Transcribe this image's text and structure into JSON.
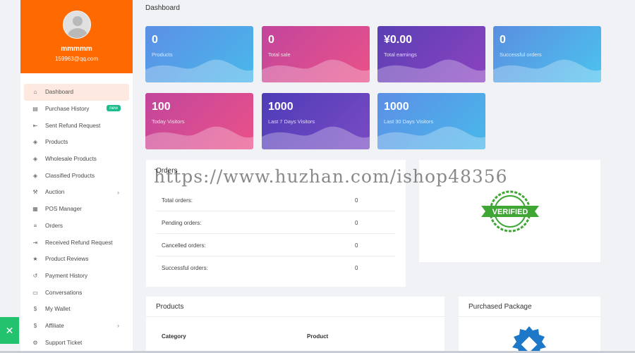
{
  "user": {
    "name": "mmmmm",
    "email": "159963@qq.com"
  },
  "page_title": "Dashboard",
  "menu": [
    {
      "label": "Dashboard",
      "icon": "⌂",
      "icon_name": "home-icon",
      "active": true
    },
    {
      "label": "Purchase History",
      "icon": "▤",
      "icon_name": "document-icon",
      "badge": "new"
    },
    {
      "label": "Sent Refund Request",
      "icon": "⇤",
      "icon_name": "refund-icon"
    },
    {
      "label": "Products",
      "icon": "◈",
      "icon_name": "diamond-icon"
    },
    {
      "label": "Wholesale Products",
      "icon": "◈",
      "icon_name": "diamond-icon"
    },
    {
      "label": "Classified Products",
      "icon": "◈",
      "icon_name": "diamond-icon"
    },
    {
      "label": "Auction",
      "icon": "⚒",
      "icon_name": "gavel-icon",
      "chevron": true
    },
    {
      "label": "POS Manager",
      "icon": "▦",
      "icon_name": "pos-icon"
    },
    {
      "label": "Orders",
      "icon": "≡",
      "icon_name": "list-icon"
    },
    {
      "label": "Received Refund Request",
      "icon": "⇥",
      "icon_name": "refund-received-icon"
    },
    {
      "label": "Product Reviews",
      "icon": "★",
      "icon_name": "star-icon"
    },
    {
      "label": "Payment History",
      "icon": "↺",
      "icon_name": "history-icon"
    },
    {
      "label": "Conversations",
      "icon": "▭",
      "icon_name": "chat-icon"
    },
    {
      "label": "My Wallet",
      "icon": "$",
      "icon_name": "dollar-icon"
    },
    {
      "label": "Affiliate",
      "icon": "$",
      "icon_name": "dollar-icon",
      "chevron": true
    },
    {
      "label": "Support Ticket",
      "icon": "⚙",
      "icon_name": "ticket-icon"
    }
  ],
  "stats": [
    {
      "value": "0",
      "label": "Products"
    },
    {
      "value": "0",
      "label": "Total sale"
    },
    {
      "value": "¥0.00",
      "label": "Total earnings"
    },
    {
      "value": "0",
      "label": "Successful orders"
    },
    {
      "value": "100",
      "label": "Today Visitors"
    },
    {
      "value": "1000",
      "label": "Last 7 Days Visitors"
    },
    {
      "value": "1000",
      "label": "Last 30 Days Visitors"
    }
  ],
  "orders": {
    "title": "Orders",
    "rows": [
      {
        "label": "Total orders:",
        "value": "0"
      },
      {
        "label": "Pending orders:",
        "value": "0"
      },
      {
        "label": "Cancelled orders:",
        "value": "0"
      },
      {
        "label": "Successful orders:",
        "value": "0"
      }
    ]
  },
  "verified": {
    "badge_text": "VERIFIED"
  },
  "products_panel": {
    "title": "Products",
    "columns": [
      "Category",
      "Product"
    ]
  },
  "package_panel": {
    "title": "Purchased Package"
  },
  "watermark": "https://www.huzhan.com/ishop48356",
  "colors": {
    "profile_bg": "#ff6a00",
    "active_menu_bg": "#fde9df",
    "badge_new": "#1cbc8d",
    "verified_green": "#3fa535"
  }
}
